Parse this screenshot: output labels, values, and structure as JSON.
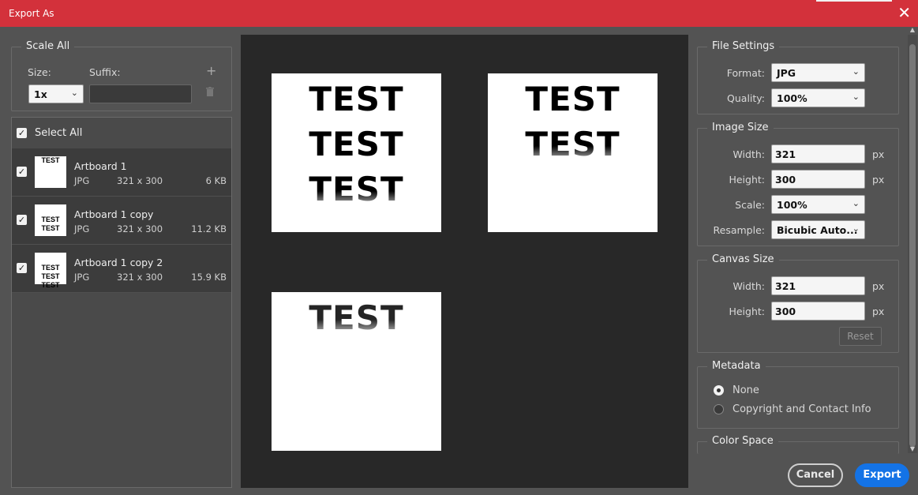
{
  "window": {
    "title": "Export As",
    "close_glyph": "✕"
  },
  "scale_all": {
    "legend": "Scale All",
    "size_label": "Size:",
    "suffix_label": "Suffix:",
    "size_value": "1x",
    "suffix_value": "",
    "add_glyph": "+",
    "delete_glyph": "🗑"
  },
  "list": {
    "select_all_label": "Select All",
    "items": [
      {
        "name": "Artboard 1",
        "format": "JPG",
        "dims": "321 x 300",
        "size": "6 KB",
        "thumb": "TEST"
      },
      {
        "name": "Artboard 1 copy",
        "format": "JPG",
        "dims": "321 x 300",
        "size": "11.2 KB",
        "thumb": "TEST\nTEST"
      },
      {
        "name": "Artboard 1 copy 2",
        "format": "JPG",
        "dims": "321 x 300",
        "size": "15.9 KB",
        "thumb": "TEST\nTEST\nTEST"
      }
    ]
  },
  "preview": {
    "art1": [
      "TEST",
      "TEST",
      "TEST"
    ],
    "art2": [
      "TEST",
      "TEST"
    ],
    "art3": [
      "TEST"
    ]
  },
  "file_settings": {
    "legend": "File Settings",
    "format_label": "Format:",
    "format_value": "JPG",
    "quality_label": "Quality:",
    "quality_value": "100%"
  },
  "image_size": {
    "legend": "Image Size",
    "width_label": "Width:",
    "width_value": "321",
    "height_label": "Height:",
    "height_value": "300",
    "unit": "px",
    "scale_label": "Scale:",
    "scale_value": "100%",
    "resample_label": "Resample:",
    "resample_value": "Bicubic Auto..."
  },
  "canvas_size": {
    "legend": "Canvas Size",
    "width_label": "Width:",
    "width_value": "321",
    "height_label": "Height:",
    "height_value": "300",
    "unit": "px",
    "reset_label": "Reset"
  },
  "metadata": {
    "legend": "Metadata",
    "option_none": "None",
    "option_copyright": "Copyright and Contact Info",
    "selected": "None"
  },
  "color_space": {
    "legend": "Color Space"
  },
  "footer": {
    "cancel_label": "Cancel",
    "export_label": "Export"
  },
  "colors": {
    "titlebar": "#d3313b",
    "accent": "#1473e6",
    "panel": "#535353",
    "preview_bg": "#282828"
  }
}
